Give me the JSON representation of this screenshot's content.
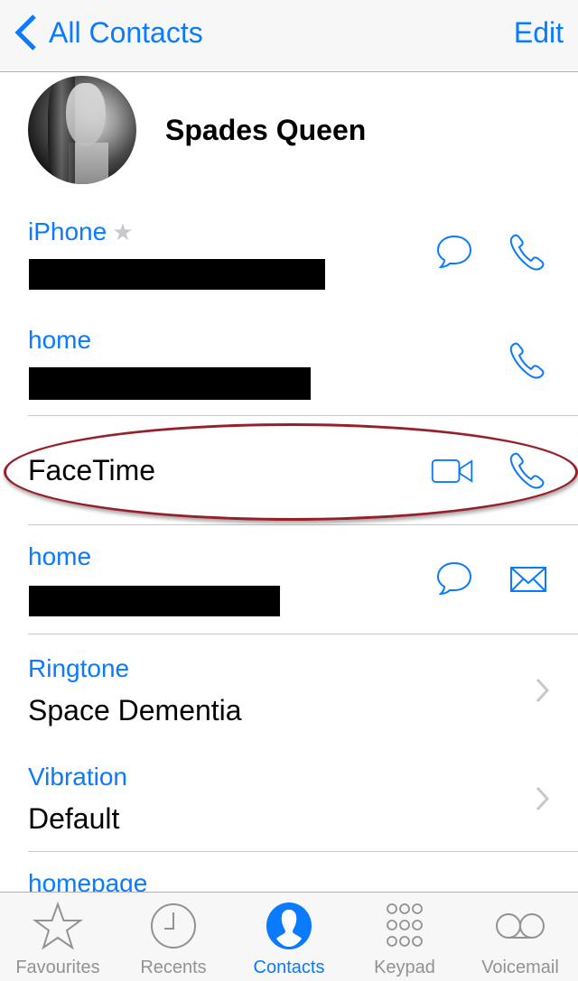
{
  "navbar": {
    "back_label": "All Contacts",
    "edit_label": "Edit"
  },
  "contact": {
    "name": "Spades Queen"
  },
  "fields": [
    {
      "label": "iPhone",
      "favorite": "★",
      "value_redacted": true,
      "actions": [
        "message-icon",
        "phone-icon"
      ]
    },
    {
      "label": "home",
      "value_redacted": true,
      "actions": [
        "phone-icon"
      ]
    },
    {
      "label": "FaceTime",
      "actions": [
        "video-icon",
        "phone-icon"
      ],
      "highlighted": true
    },
    {
      "label": "home",
      "value_redacted": true,
      "actions": [
        "message-icon",
        "mail-icon"
      ]
    },
    {
      "label": "Ringtone",
      "value": "Space Dementia",
      "actions": [
        "chevron-right-icon"
      ]
    },
    {
      "label": "Vibration",
      "value": "Default",
      "actions": [
        "chevron-right-icon"
      ]
    },
    {
      "label": "homepage"
    }
  ],
  "tabbar": {
    "tabs": [
      {
        "label": "Favourites",
        "icon": "star-icon",
        "active": false
      },
      {
        "label": "Recents",
        "icon": "clock-icon",
        "active": false
      },
      {
        "label": "Contacts",
        "icon": "contacts-icon",
        "active": true
      },
      {
        "label": "Keypad",
        "icon": "keypad-icon",
        "active": false
      },
      {
        "label": "Voicemail",
        "icon": "voicemail-icon",
        "active": false
      }
    ]
  },
  "colors": {
    "accent": "#0a7aff",
    "annotation": "#96202a",
    "inactive": "#929292"
  }
}
